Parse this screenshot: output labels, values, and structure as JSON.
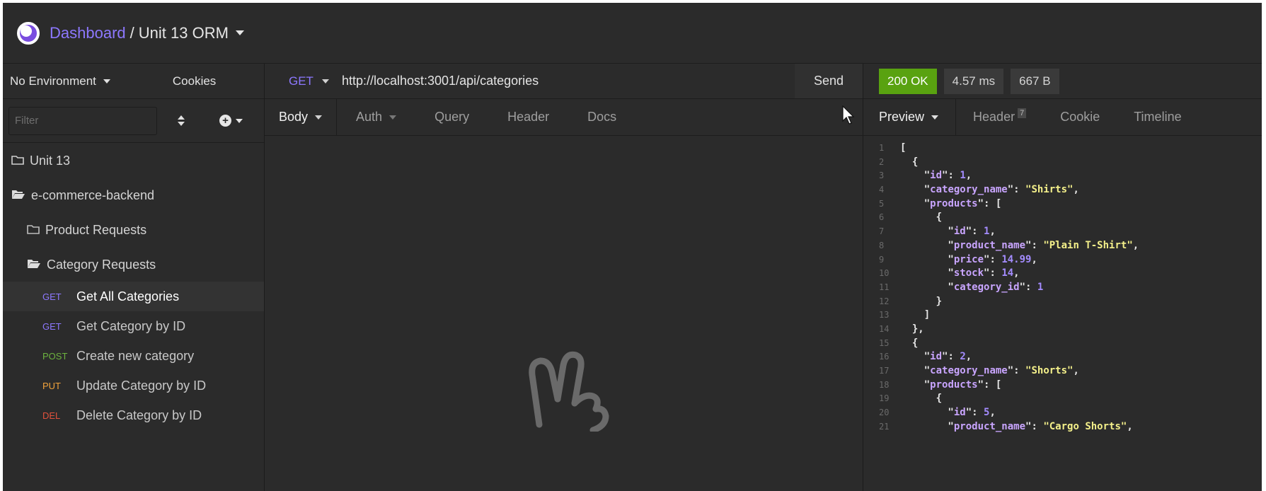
{
  "header": {
    "breadcrumb_root": "Dashboard",
    "breadcrumb_sep": "/",
    "project": "Unit 13 ORM"
  },
  "sidebar": {
    "environment": "No Environment",
    "cookies": "Cookies",
    "filter_placeholder": "Filter",
    "folders": {
      "unit": "Unit 13",
      "backend": "e-commerce-backend",
      "product_requests": "Product Requests",
      "category_requests": "Category Requests"
    },
    "requests": [
      {
        "method": "GET",
        "label": "Get All Categories",
        "color": "#8d78ff",
        "active": true
      },
      {
        "method": "GET",
        "label": "Get Category by ID",
        "color": "#8d78ff",
        "active": false
      },
      {
        "method": "POST",
        "label": "Create new category",
        "color": "#6db33f",
        "active": false
      },
      {
        "method": "PUT",
        "label": "Update Category by ID",
        "color": "#f0a23b",
        "active": false
      },
      {
        "method": "DEL",
        "label": "Delete Category by ID",
        "color": "#e0513c",
        "active": false
      }
    ]
  },
  "request": {
    "method": "GET",
    "url": "http://localhost:3001/api/categories",
    "send": "Send",
    "tabs": {
      "body": "Body",
      "auth": "Auth",
      "query": "Query",
      "header": "Header",
      "docs": "Docs"
    }
  },
  "response": {
    "status": "200 OK",
    "time": "4.57 ms",
    "size": "667 B",
    "tabs": {
      "preview": "Preview",
      "header": "Header",
      "header_count": "7",
      "cookie": "Cookie",
      "timeline": "Timeline"
    },
    "lines": [
      "[",
      "  {",
      "    \"id\": 1,",
      "    \"category_name\": \"Shirts\",",
      "    \"products\": [",
      "      {",
      "        \"id\": 1,",
      "        \"product_name\": \"Plain T-Shirt\",",
      "        \"price\": 14.99,",
      "        \"stock\": 14,",
      "        \"category_id\": 1",
      "      }",
      "    ]",
      "  },",
      "  {",
      "    \"id\": 2,",
      "    \"category_name\": \"Shorts\",",
      "    \"products\": [",
      "      {",
      "        \"id\": 5,",
      "        \"product_name\": \"Cargo Shorts\","
    ]
  },
  "colors": {
    "accent": "#8d78ff",
    "status_ok": "#59a210",
    "background": "#2b2b2b"
  }
}
